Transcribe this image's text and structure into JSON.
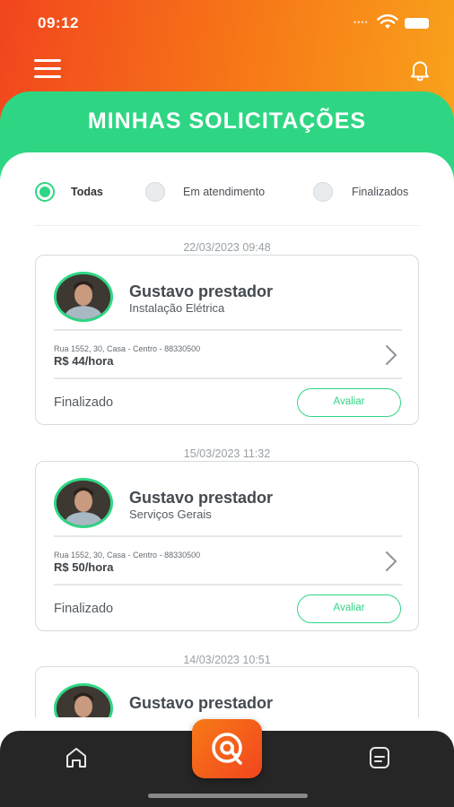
{
  "status_bar": {
    "time": "09:12"
  },
  "header": {
    "title": "MINHAS SOLICITAÇÕES",
    "menu_icon": "hamburger-menu-icon",
    "notification_icon": "bell-icon"
  },
  "filters": [
    {
      "label": "Todas",
      "selected": true
    },
    {
      "label": "Em atendimento",
      "selected": false
    },
    {
      "label": "Finalizados",
      "selected": false
    }
  ],
  "requests": [
    {
      "date": "22/03/2023 09:48",
      "provider_name": "Gustavo prestador",
      "service": "Instalação Elétrica",
      "address": "Rua 1552, 30, Casa - Centro - 88330500",
      "price": "R$ 44/hora",
      "status": "Finalizado",
      "action_label": "Avaliar"
    },
    {
      "date": "15/03/2023 11:32",
      "provider_name": "Gustavo prestador",
      "service": "Serviços Gerais",
      "address": "Rua 1552, 30, Casa - Centro - 88330500",
      "price": "R$ 50/hora",
      "status": "Finalizado",
      "action_label": "Avaliar"
    },
    {
      "date": "14/03/2023 10:51",
      "provider_name": "Gustavo prestador"
    }
  ],
  "bottom_nav": {
    "home_icon": "home-icon",
    "center_icon": "at-sign-icon",
    "documents_icon": "document-icon"
  },
  "colors": {
    "accent_green": "#2ed683",
    "brand_orange": "#f77a17",
    "brand_red_orange": "#f2451e",
    "nav_dark": "#262626"
  }
}
